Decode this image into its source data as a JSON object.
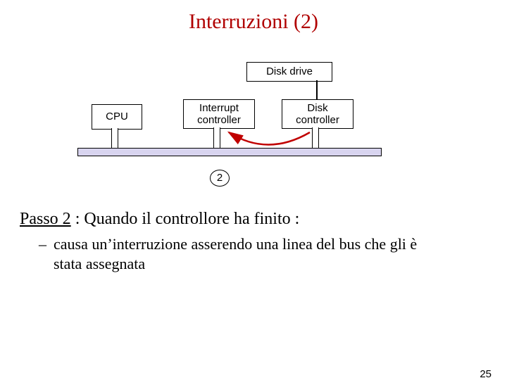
{
  "title": "Interruzioni (2)",
  "diagram": {
    "disk_drive": "Disk drive",
    "cpu": "CPU",
    "interrupt_controller_l1": "Interrupt",
    "interrupt_controller_l2": "controller",
    "disk_controller_l1": "Disk",
    "disk_controller_l2": "controller",
    "step_number": "2"
  },
  "body": {
    "heading_prefix": "Passo 2",
    "heading_rest": " : Quando il controllore ha finito :",
    "bullet1": "causa un’interruzione asserendo una linea del bus che gli è stata assegnata"
  },
  "slide_number": "25"
}
